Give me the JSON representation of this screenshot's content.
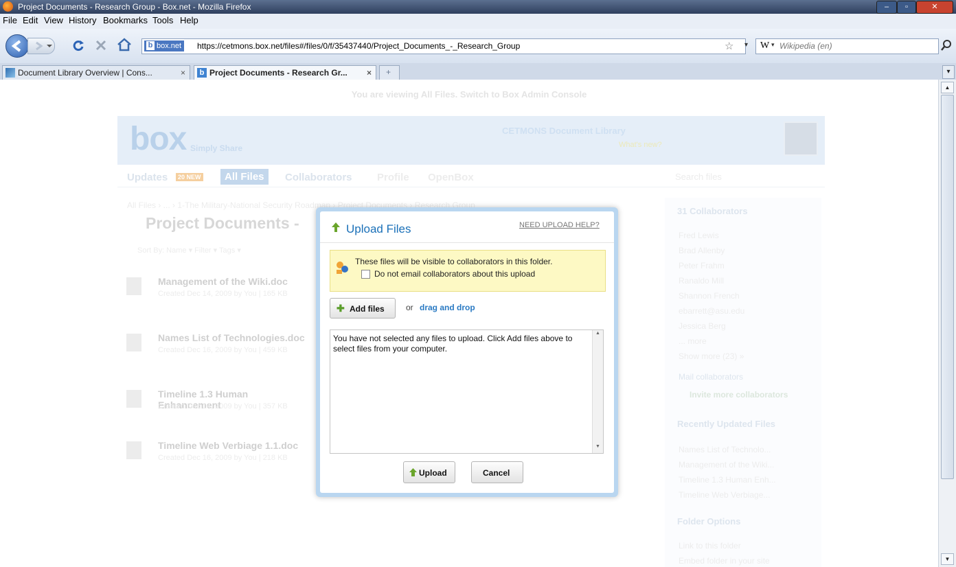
{
  "window": {
    "title": "Project Documents - Research Group - Box.net - Mozilla Firefox",
    "min": "–",
    "max": "▫",
    "close": "✕"
  },
  "menu": [
    "File",
    "Edit",
    "View",
    "History",
    "Bookmarks",
    "Tools",
    "Help"
  ],
  "nav": {
    "site_badge": "box.net",
    "url": "https://cetmons.box.net/files#/files/0/f/35437440/Project_Documents_-_Research_Group",
    "search_engine_letter": "W",
    "search_placeholder": "Wikipedia (en)"
  },
  "tabs": [
    {
      "label": "Document Library Overview | Cons...",
      "close": "×"
    },
    {
      "label": "Project Documents - Research Gr...",
      "close": "×"
    }
  ],
  "new_tab_symbol": "+",
  "page": {
    "banner": "You are viewing All Files. Switch to Box Admin Console",
    "logo": "box",
    "tagline": "Simply Share",
    "library_name": "CETMONS Document Library",
    "whats_new": "What's new?",
    "nav": [
      "Updates",
      "All Files",
      "Collaborators",
      "Profile",
      "OpenBox"
    ],
    "updates_badge": "20 NEW",
    "search_files": "Search files",
    "breadcrumb": "All Files › ... › 1-The Military-National Security Roadmap › Project Documents › Research Group",
    "folder_title": "Project Documents -",
    "sort_by": "Sort By: Name ▾   Filter ▾   Tags ▾",
    "files": [
      {
        "name": "Management of the Wiki.doc",
        "meta": "Created Dec 14, 2009 by You | 165 KB"
      },
      {
        "name": "Names List of Technologies.doc",
        "meta": "Created Dec 16, 2009 by You | 459 KB"
      },
      {
        "name": "Timeline 1.3 Human Enhancement",
        "meta": "Created Dec 14, 2009 by You | 357 KB"
      },
      {
        "name": "Timeline Web Verbiage 1.1.doc",
        "meta": "Created Dec 16, 2009 by You | 218 KB"
      }
    ],
    "sidebar": {
      "collaborators_title": "31 Collaborators",
      "collaborators": [
        "Fred Lewis",
        "Brad Allenby",
        "Peter Frahm",
        "Ranaldo Mill",
        "Shannon French",
        "ebarrett@asu.edu",
        "Jessica Berg",
        "... more",
        "Show more (23) »"
      ],
      "email_collab": "Mail collaborators",
      "invite": "Invite more collaborators",
      "recent_title": "Recently Updated Files",
      "recent": [
        "Names List of Technolo...",
        "Management of the Wiki...",
        "Timeline 1.3 Human Enh...",
        "Timeline Web Verbiage..."
      ],
      "folder_title": "Folder Options",
      "folder_links": [
        "Link to this folder",
        "Embed folder in your site"
      ]
    }
  },
  "modal": {
    "title": "Upload Files",
    "help": "NEED UPLOAD HELP?",
    "notice": "These files will be visible to collaborators in this folder.",
    "no_email": "Do not email collaborators about this upload",
    "add_files": "Add files",
    "or": "or",
    "drag_drop": "drag and drop",
    "empty_msg": "You have not selected any files to upload. Click Add files above to select files from your computer.",
    "upload": "Upload",
    "cancel": "Cancel"
  },
  "colors": {
    "accent": "#1a70b8",
    "link": "#2a7ac3",
    "notice_bg": "#fdf9c4"
  }
}
